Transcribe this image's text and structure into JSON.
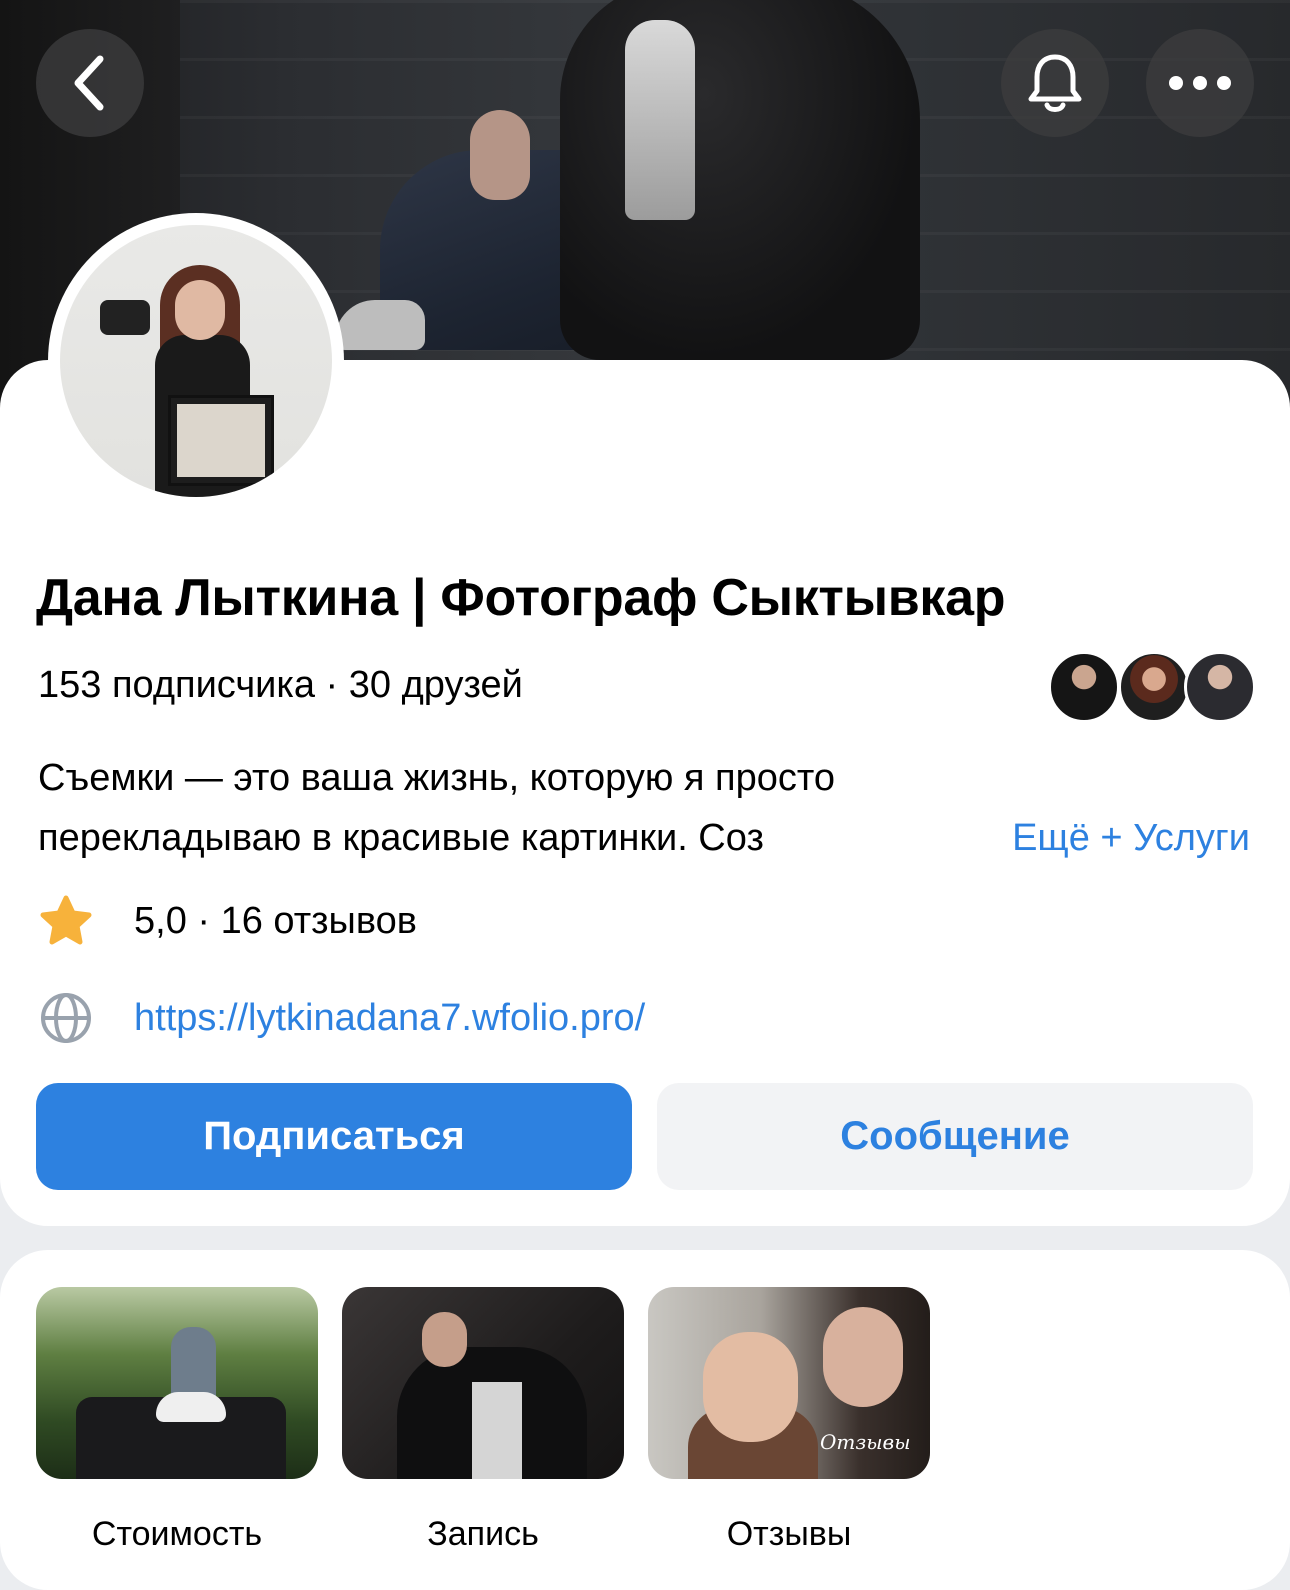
{
  "header": {
    "back_icon": "chevron-left-icon",
    "bell_icon": "bell-icon",
    "more_icon": "more-horizontal-icon"
  },
  "profile": {
    "name": "Дана Лыткина | Фотограф Сыктывкар",
    "stats": "153 подписчика · 30 друзей",
    "description_line1": "Съемки — это ваша жизнь, которую я просто",
    "description_line2": "перекладываю в красивые картинки. Соз",
    "more_link": "Ещё + Услуги",
    "rating": "5,0 · 16 отзывов",
    "rating_icon": "star-icon",
    "website": "https://lytkinadana7.wfolio.pro/",
    "website_icon": "globe-icon"
  },
  "actions": {
    "subscribe_label": "Подписаться",
    "message_label": "Сообщение"
  },
  "highlights": [
    {
      "label": "Стоимость"
    },
    {
      "label": "Запись"
    },
    {
      "label": "Отзывы",
      "overlay_text": "Отзывы"
    }
  ],
  "colors": {
    "accent": "#2d81e0",
    "star": "#f7b23b",
    "secondary_button_bg": "#f2f3f5",
    "page_bg": "#ebedf0"
  }
}
